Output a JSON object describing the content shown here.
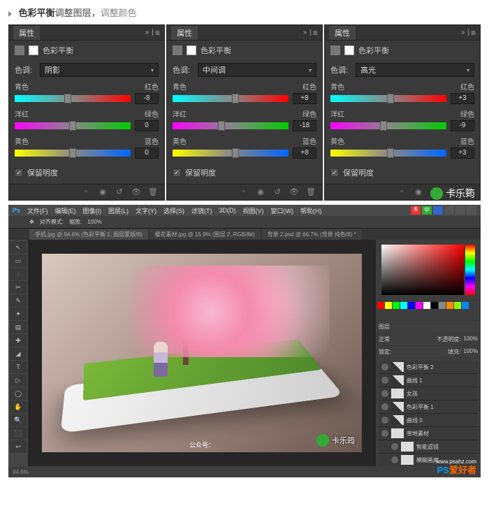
{
  "header": {
    "bullet_label": "色彩平衡",
    "t2": "调整图层，",
    "t3": "调整颜色"
  },
  "panels": [
    {
      "tab": "属性",
      "title": "色彩平衡",
      "tone_label": "色调:",
      "tone_value": "阴影",
      "sliders": [
        {
          "left": "青色",
          "right": "红色",
          "value": "-8",
          "pos": 46
        },
        {
          "left": "洋红",
          "right": "绿色",
          "value": "0",
          "pos": 50
        },
        {
          "left": "黄色",
          "right": "蓝色",
          "value": "0",
          "pos": 50
        }
      ],
      "preserve": "保留明度"
    },
    {
      "tab": "属性",
      "title": "色彩平衡",
      "tone_label": "色调:",
      "tone_value": "中间调",
      "sliders": [
        {
          "left": "青色",
          "right": "红色",
          "value": "+8",
          "pos": 54
        },
        {
          "left": "洋红",
          "right": "绿色",
          "value": "-18",
          "pos": 42
        },
        {
          "left": "黄色",
          "right": "蓝色",
          "value": "+8",
          "pos": 54
        }
      ],
      "preserve": "保留明度"
    },
    {
      "tab": "属性",
      "title": "色彩平衡",
      "tone_label": "色调:",
      "tone_value": "高光",
      "sliders": [
        {
          "left": "青色",
          "right": "红色",
          "value": "+3",
          "pos": 52
        },
        {
          "left": "洋红",
          "right": "绿色",
          "value": "-9",
          "pos": 46
        },
        {
          "left": "黄色",
          "right": "蓝色",
          "value": "+3",
          "pos": 52
        }
      ],
      "preserve": "保留明度"
    }
  ],
  "watermark_panels": "卡乐筠",
  "ps": {
    "menu": [
      "Ps",
      "文件(F)",
      "编辑(E)",
      "图像(I)",
      "图层(L)",
      "文字(Y)",
      "选择(S)",
      "滤镜(T)",
      "3D(D)",
      "视图(V)",
      "窗口(W)",
      "帮助(H)"
    ],
    "opts_label": "对齐模式:",
    "opts_zoom": "100%",
    "opts_extra": "缩放: ",
    "tabs": [
      "手机.jpg @ 94.6% (色彩平衡 1, 图层蒙版/8)",
      "樱花素材.jpg @ 15.9% (图层 2, RGB/8#)",
      "背景 2.psd @ 66.7% (背景 纯色/8) *"
    ],
    "layers_header": "图层",
    "blend": "正常",
    "opacity_label": "不透明度:",
    "opacity": "100%",
    "lock": "锁定:",
    "fill_label": "填充:",
    "fill": "100%",
    "layers": [
      {
        "name": "色彩平衡 2",
        "adj": true
      },
      {
        "name": "曲线 1",
        "adj": true
      },
      {
        "name": "女孩",
        "adj": false
      },
      {
        "name": "色彩平衡 1",
        "adj": true
      },
      {
        "name": "曲线 0",
        "adj": true
      },
      {
        "name": "草地素材",
        "adj": false,
        "open": true
      },
      {
        "name": "智能滤镜",
        "adj": false,
        "sub": true
      },
      {
        "name": "模糊画廊",
        "adj": false,
        "sub": true
      }
    ],
    "status": "94.6%",
    "wm_canvas": "卡乐筠",
    "wm_sub": "公众号：",
    "wm_site": "www.psahz.com",
    "wm_brand_p": "PS",
    "wm_brand_r": "爱好者"
  }
}
